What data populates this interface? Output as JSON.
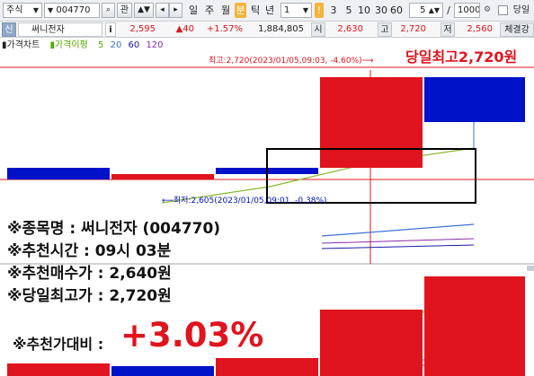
{
  "toolbar": {
    "market": "주식",
    "code": "004770",
    "search_icon": "magnifier-icon",
    "btn_watch": "관",
    "periods": [
      "일",
      "주",
      "월",
      "분",
      "틱",
      "년"
    ],
    "active_period": "분",
    "interval_value": "1",
    "interval_options": [
      "3",
      "5",
      "10",
      "30",
      "60"
    ],
    "count_value": "5",
    "slash": "/",
    "total_value": "1000",
    "today_label": "당일",
    "colors": {
      "accent": "#f2b43a",
      "up": "#e0141e",
      "down": "#0012c8"
    }
  },
  "quote": {
    "badge": "신",
    "name": "써니전자",
    "info_icon": "i",
    "price": "2,595",
    "change": "▲40",
    "change_pct": "+1.57%",
    "volume": "1,884,805",
    "open_label": "시",
    "open": "2,630",
    "high_label": "고",
    "high": "2,720",
    "low_label": "저",
    "low": "2,560",
    "button": "체결강"
  },
  "legend": {
    "price_chart": "가격차트",
    "ma_label": "가격이평",
    "ma_periods": [
      "5",
      "20",
      "60",
      "120"
    ],
    "ma_colors": [
      "#55aa00",
      "#3d6fd6",
      "#1a1aa6",
      "#8a2aa6"
    ]
  },
  "chart_data": {
    "type": "candlestick",
    "annotation_high": "최고:2,720(2023/01/05,09:03, -4.60%)⟶",
    "annotation_low": "⟵최저:2,605(2023/01/05,09:01, -0.38%)",
    "candles": [
      {
        "color": "down"
      },
      {
        "color": "up"
      },
      {
        "color": "down"
      },
      {
        "color": "up"
      },
      {
        "color": "down"
      }
    ]
  },
  "overlay": {
    "line1": "※종목명 : 써니전자 (004770)",
    "line2": "※추천시간 : 09시 03분",
    "line3": "※추천매수가 : 2,640원",
    "line4": "※당일최고가 : 2,720원",
    "pct_label": "※추천가대비 :",
    "pct_value": "+3.03%",
    "high_banner": "당일최고2,720원"
  }
}
